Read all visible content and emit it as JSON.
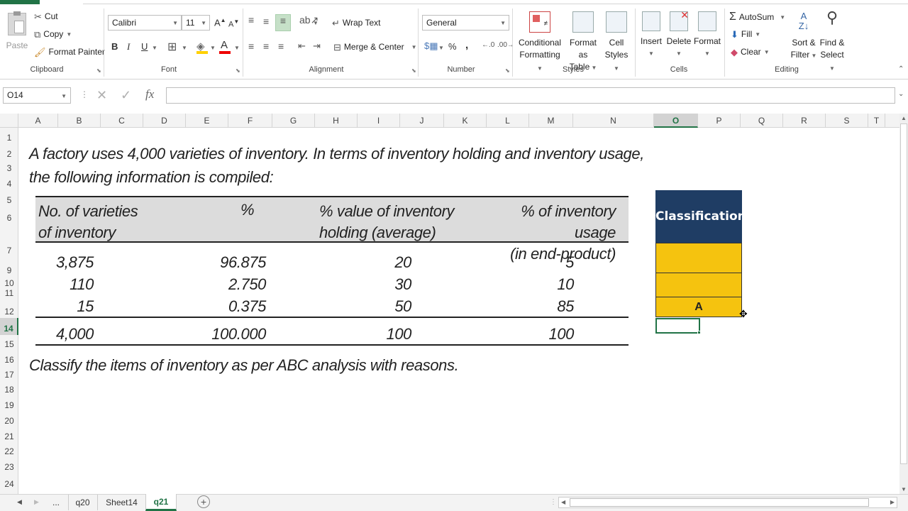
{
  "ribbon": {
    "clipboard": {
      "paste": "Paste",
      "cut": "Cut",
      "copy": "Copy",
      "format_painter": "Format Painter",
      "label": "Clipboard"
    },
    "font": {
      "name": "Calibri",
      "size": "11",
      "label": "Font",
      "bold": "B",
      "italic": "I",
      "underline": "U"
    },
    "alignment": {
      "wrap": "Wrap Text",
      "merge": "Merge & Center",
      "label": "Alignment"
    },
    "number": {
      "format": "General",
      "percent": "%",
      "comma": ",",
      "label": "Number"
    },
    "styles": {
      "conditional_l1": "Conditional",
      "conditional_l2": "Formatting",
      "table_l1": "Format as",
      "table_l2": "Table",
      "cell_l1": "Cell",
      "cell_l2": "Styles",
      "label": "Styles"
    },
    "cells": {
      "insert": "Insert",
      "delete": "Delete",
      "format": "Format",
      "label": "Cells"
    },
    "editing": {
      "autosum": "AutoSum",
      "fill": "Fill",
      "clear": "Clear",
      "sort_l1": "Sort &",
      "sort_l2": "Filter",
      "find_l1": "Find &",
      "find_l2": "Select",
      "label": "Editing"
    }
  },
  "formula_bar": {
    "name_box": "O14",
    "fx": "fx",
    "value": ""
  },
  "columns": [
    "A",
    "B",
    "C",
    "D",
    "E",
    "F",
    "G",
    "H",
    "I",
    "J",
    "K",
    "L",
    "M",
    "N",
    "O",
    "P",
    "Q",
    "R",
    "S",
    "T"
  ],
  "rows": [
    "1",
    "2",
    "3",
    "4",
    "5",
    "6",
    "7",
    "9",
    "10",
    "11",
    "12",
    "14",
    "15",
    "16",
    "17",
    "18",
    "19",
    "20",
    "21",
    "22",
    "23",
    "24"
  ],
  "content": {
    "intro_line1": "A factory uses 4,000 varieties of inventory. In terms of inventory holding and inventory usage,",
    "intro_line2": "the following information is compiled:",
    "headers": {
      "h1_l1": "No. of varieties",
      "h1_l2": "of inventory",
      "h2": "%",
      "h3_l1": "% value of inventory",
      "h3_l2": "holding (average)",
      "h4_l1": "% of inventory usage",
      "h4_l2": "(in end-product)"
    },
    "rows": [
      {
        "varieties": "3,875",
        "pct": "96.875",
        "holding": "20",
        "usage": "5"
      },
      {
        "varieties": "110",
        "pct": "2.750",
        "holding": "30",
        "usage": "10"
      },
      {
        "varieties": "15",
        "pct": "0.375",
        "holding": "50",
        "usage": "85"
      }
    ],
    "total": {
      "varieties": "4,000",
      "pct": "100.000",
      "holding": "100",
      "usage": "100"
    },
    "question": "Classify the items of inventory as per ABC analysis with reasons."
  },
  "classification": {
    "header": "Classification",
    "row1": "",
    "row2": "",
    "row3": "A",
    "header_color": "#1f3d64",
    "cell_color": "#f5c30f"
  },
  "tabs": {
    "more": "...",
    "tab1": "q20",
    "tab2": "Sheet14",
    "tab3": "q21",
    "active": "q21"
  }
}
